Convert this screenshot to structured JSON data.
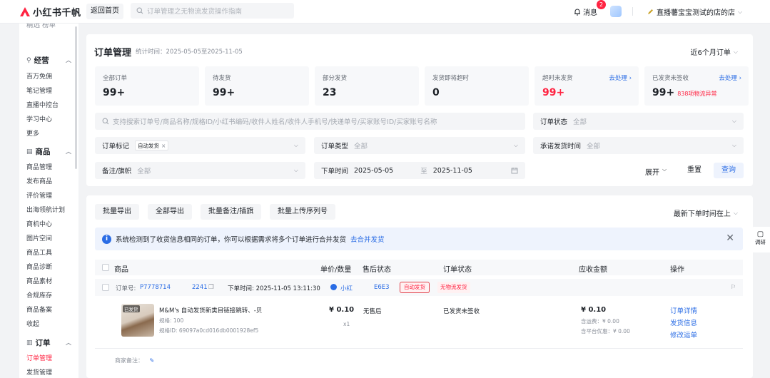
{
  "app": {
    "logo_text": "小红书千帆",
    "brand_color": "#ff2442"
  },
  "topbar": {
    "back_label": "返回首页",
    "search_placeholder": "订单管理之无物流发货操作指南",
    "message_label": "消息",
    "message_count": "2",
    "store_name": "直播薯宝宝测试的店的店"
  },
  "sidebar": {
    "top_partial": "精选  榜单",
    "groups": [
      {
        "label": "经营",
        "icon": "wrench-icon",
        "items": [
          "百万免佣",
          "笔记管理",
          "直播中控台",
          "学习中心",
          "更多"
        ]
      },
      {
        "label": "商品",
        "icon": "box-icon",
        "items": [
          "商品管理",
          "发布商品",
          "评价管理",
          "出海领航计划",
          "商机中心",
          "图片空间",
          "商品工具",
          "商品诊断",
          "商品素材",
          "合规库存",
          "商品备案",
          "收起"
        ]
      },
      {
        "label": "订单",
        "icon": "order-icon",
        "items": [
          "订单管理",
          "发货管理"
        ]
      }
    ],
    "active_item": "订单管理"
  },
  "header": {
    "title": "订单管理",
    "stat_range": "统计时间：2025-05-05至2025-11-05",
    "range_select": "近6个月订单"
  },
  "stats": [
    {
      "label": "全部订单",
      "value": "99+"
    },
    {
      "label": "待发货",
      "value": "99+"
    },
    {
      "label": "部分发货",
      "value": "23"
    },
    {
      "label": "发货即将超时",
      "value": "0"
    },
    {
      "label": "超时未发货",
      "value": "99+",
      "action": "去处理 ›",
      "highlight": true
    },
    {
      "label": "已发货未签收",
      "value": "99+",
      "action": "去处理 ›",
      "extra": "838项物流异常"
    }
  ],
  "filters": {
    "search_placeholder": "支持搜索订单号/商品名称/规格ID/小红书编码/收件人姓名/收件人手机号/快递单号/买家账号ID/买家账号名称",
    "order_status_label": "订单状态",
    "order_status_value": "全部",
    "order_mark_label": "订单标记",
    "order_mark_tag": "自动发货",
    "order_type_label": "订单类型",
    "order_type_value": "全部",
    "promise_time_label": "承诺发货时间",
    "promise_time_value": "全部",
    "remark_label": "备注/旗帜",
    "remark_value": "全部",
    "order_time_label": "下单时间",
    "date_start": "2025-05-05",
    "date_sep": "至",
    "date_end": "2025-11-05",
    "expand_label": "展开",
    "reset_label": "重置",
    "query_label": "查询"
  },
  "toolbar": {
    "batch_export": "批量导出",
    "export_all": "全部导出",
    "batch_remark": "批量备注/插旗",
    "batch_upload": "批量上传序列号",
    "sort_label": "最新下单时间在上"
  },
  "notice": {
    "text": "系统检测到了收货信息相同的订单，你可以根据需求将多个订单进行合并发货",
    "link": "去合并发货"
  },
  "table": {
    "columns": [
      "商品",
      "单价/数量",
      "售后状态",
      "订单状态",
      "应收金额",
      "操作"
    ]
  },
  "order": {
    "order_no_label": "订单号:",
    "order_no_a": "P7778714",
    "order_no_b": "2241",
    "order_time": "下单时间: 2025-11-05 13:11:30",
    "buyer": "小红",
    "buyer_code": "E6E3",
    "tag_auto": "自动发货",
    "tag_nologistics": "无物流发货",
    "product_thumb_label": "已发货",
    "product_name": "M&M's 自动发货新类目链接跳转、-贝",
    "spec": "规格: 100",
    "spec_id": "规格ID: 69097a0cd016db0001928ef5",
    "price": "¥ 0.10",
    "qty": "x1",
    "aftersale": "无售后",
    "status": "已发货未签收",
    "amount": "¥ 0.10",
    "shipping_fee": "含运费：¥ 0.00",
    "platform_discount": "含平台优惠：¥ 0.00",
    "actions": [
      "订单详情",
      "发货信息",
      "修改运单"
    ],
    "merchant_remark": "商家备注："
  },
  "float_tool": {
    "label": "调研"
  }
}
